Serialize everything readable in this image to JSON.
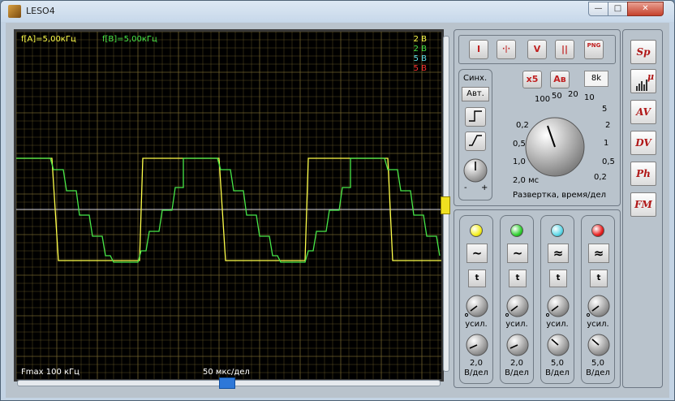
{
  "window": {
    "title": "LESO4",
    "min": "—",
    "max": "□",
    "close": "✕"
  },
  "scope": {
    "freq_a": "f[A]=5,00кГц",
    "freq_b": "f[B]=5,00кГц",
    "volts": [
      "2 В",
      "2 В",
      "5 В",
      "5 В"
    ],
    "fmax": "Fmax 100 кГц",
    "time_div": "50 мкс/дел"
  },
  "toolbar": {
    "run": "I",
    "cursor": "·|·",
    "volt": "V",
    "pause": "||",
    "png": "PNG"
  },
  "sync": {
    "title": "Синх.",
    "auto": "Авт.",
    "minus": "-",
    "plus": "+"
  },
  "sweep": {
    "x5": "x5",
    "av": "Aв",
    "k8": "8k",
    "label": "Развертка, время/дел",
    "ticks": [
      "100",
      "50",
      "20",
      "10",
      "5",
      "0,2",
      "2",
      "0,5",
      "1",
      "1,0",
      "0,5",
      "2,0 мс",
      "0,2"
    ]
  },
  "channels": [
    {
      "color": "#f5f020",
      "coupling": "~",
      "t": "t",
      "gain": "усил.",
      "vdiv1": "2,0",
      "vdiv2": "В/дел"
    },
    {
      "color": "#30d030",
      "coupling": "~",
      "t": "t",
      "gain": "усил.",
      "vdiv1": "2,0",
      "vdiv2": "В/дел"
    },
    {
      "color": "#5fd8e8",
      "coupling": "≈",
      "t": "t",
      "gain": "усил.",
      "vdiv1": "5,0",
      "vdiv2": "В/дел"
    },
    {
      "color": "#e82020",
      "coupling": "≈",
      "t": "t",
      "gain": "усил.",
      "vdiv1": "5,0",
      "vdiv2": "В/дел"
    }
  ],
  "modes": [
    "Sp",
    "μ",
    "AV",
    "DV",
    "Ph",
    "FM"
  ],
  "colors": {
    "trace_a": "#ffff4a",
    "trace_b": "#48e848",
    "grid": "#7a6a30",
    "accent": "#c02020"
  }
}
